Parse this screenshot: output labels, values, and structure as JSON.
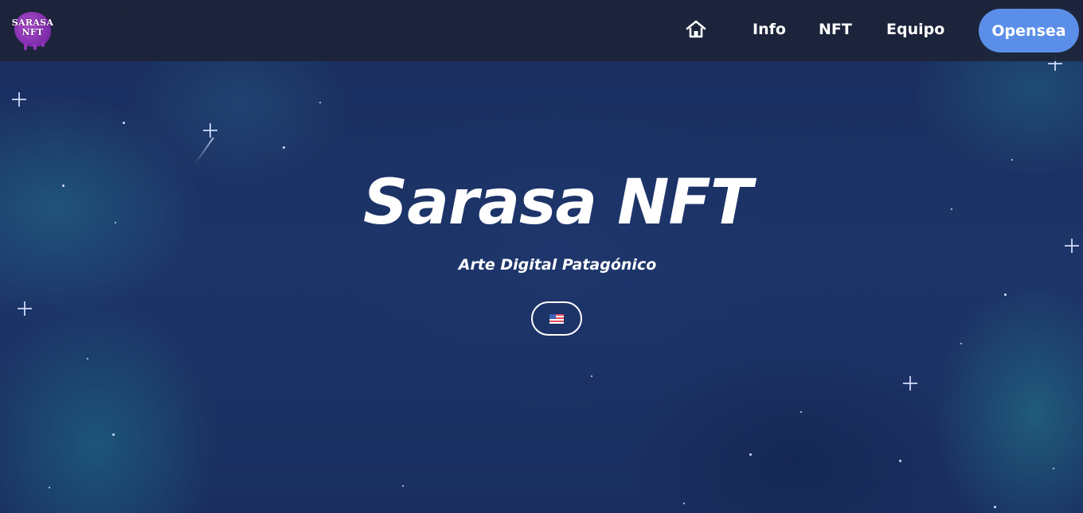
{
  "navbar": {
    "logo_text": "SARASA NFT",
    "logo_line1": "SARASA",
    "logo_line2": "NFT",
    "home_icon": "home-icon",
    "links": [
      {
        "label": "Info"
      },
      {
        "label": "NFT"
      },
      {
        "label": "Equipo"
      }
    ],
    "cta_label": "Opensea"
  },
  "hero": {
    "title": "Sarasa NFT",
    "subtitle": "Arte Digital Patagónico",
    "language_button_icon": "us-flag-icon"
  },
  "colors": {
    "navbar_bg": "#1c2438",
    "cta_bg": "#5b8ee8",
    "background": "#1b3263",
    "logo_accent": "#9b3fc4",
    "text": "#ffffff"
  }
}
